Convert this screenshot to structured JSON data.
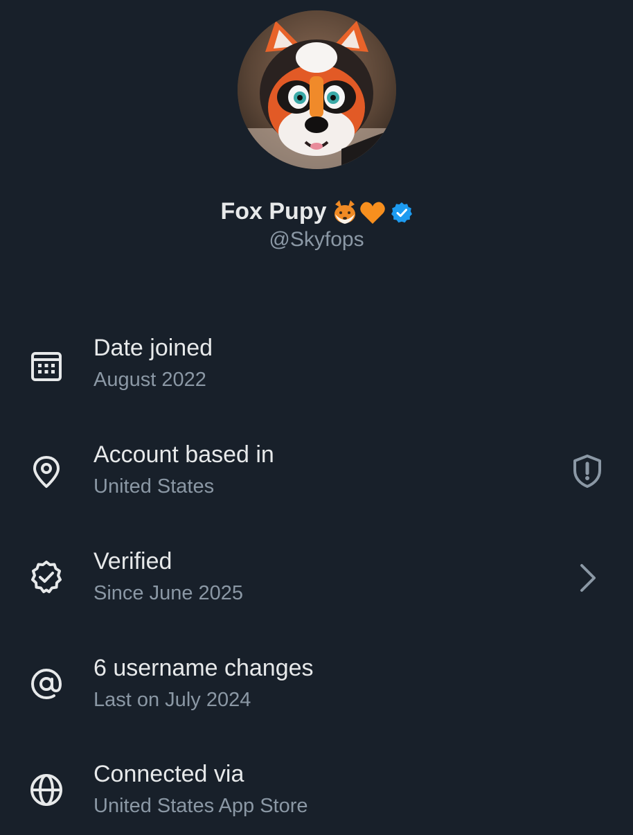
{
  "profile": {
    "display_name": "Fox Pupy",
    "name_emojis": [
      "fox-face-emoji",
      "orange-heart-emoji"
    ],
    "verified_badge_color": "#1d9bf0",
    "handle": "@Skyfops"
  },
  "colors": {
    "background": "#18202a",
    "primary_text": "#e7e9ea",
    "secondary_text": "#8b98a5",
    "chevron": "#8b98a5"
  },
  "about": {
    "items": [
      {
        "icon": "calendar-icon",
        "title": "Date joined",
        "subtitle": "August 2022"
      },
      {
        "icon": "location-pin-icon",
        "title": "Account based in",
        "subtitle": "United States",
        "trailing_icon": "shield-alert-icon"
      },
      {
        "icon": "verified-badge-icon",
        "title": "Verified",
        "subtitle": "Since June 2025",
        "trailing_icon": "chevron-right-icon"
      },
      {
        "icon": "at-sign-icon",
        "title": "6 username changes",
        "subtitle": "Last on July 2024"
      },
      {
        "icon": "globe-icon",
        "title": "Connected via",
        "subtitle": "United States App Store"
      }
    ]
  }
}
